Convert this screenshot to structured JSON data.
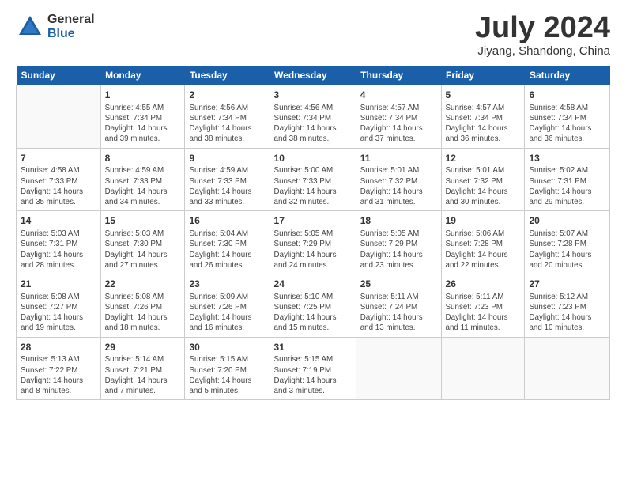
{
  "logo": {
    "general": "General",
    "blue": "Blue"
  },
  "header": {
    "month": "July 2024",
    "location": "Jiyang, Shandong, China"
  },
  "weekdays": [
    "Sunday",
    "Monday",
    "Tuesday",
    "Wednesday",
    "Thursday",
    "Friday",
    "Saturday"
  ],
  "weeks": [
    [
      {
        "day": "",
        "info": ""
      },
      {
        "day": "1",
        "info": "Sunrise: 4:55 AM\nSunset: 7:34 PM\nDaylight: 14 hours\nand 39 minutes."
      },
      {
        "day": "2",
        "info": "Sunrise: 4:56 AM\nSunset: 7:34 PM\nDaylight: 14 hours\nand 38 minutes."
      },
      {
        "day": "3",
        "info": "Sunrise: 4:56 AM\nSunset: 7:34 PM\nDaylight: 14 hours\nand 38 minutes."
      },
      {
        "day": "4",
        "info": "Sunrise: 4:57 AM\nSunset: 7:34 PM\nDaylight: 14 hours\nand 37 minutes."
      },
      {
        "day": "5",
        "info": "Sunrise: 4:57 AM\nSunset: 7:34 PM\nDaylight: 14 hours\nand 36 minutes."
      },
      {
        "day": "6",
        "info": "Sunrise: 4:58 AM\nSunset: 7:34 PM\nDaylight: 14 hours\nand 36 minutes."
      }
    ],
    [
      {
        "day": "7",
        "info": "Sunrise: 4:58 AM\nSunset: 7:33 PM\nDaylight: 14 hours\nand 35 minutes."
      },
      {
        "day": "8",
        "info": "Sunrise: 4:59 AM\nSunset: 7:33 PM\nDaylight: 14 hours\nand 34 minutes."
      },
      {
        "day": "9",
        "info": "Sunrise: 4:59 AM\nSunset: 7:33 PM\nDaylight: 14 hours\nand 33 minutes."
      },
      {
        "day": "10",
        "info": "Sunrise: 5:00 AM\nSunset: 7:33 PM\nDaylight: 14 hours\nand 32 minutes."
      },
      {
        "day": "11",
        "info": "Sunrise: 5:01 AM\nSunset: 7:32 PM\nDaylight: 14 hours\nand 31 minutes."
      },
      {
        "day": "12",
        "info": "Sunrise: 5:01 AM\nSunset: 7:32 PM\nDaylight: 14 hours\nand 30 minutes."
      },
      {
        "day": "13",
        "info": "Sunrise: 5:02 AM\nSunset: 7:31 PM\nDaylight: 14 hours\nand 29 minutes."
      }
    ],
    [
      {
        "day": "14",
        "info": "Sunrise: 5:03 AM\nSunset: 7:31 PM\nDaylight: 14 hours\nand 28 minutes."
      },
      {
        "day": "15",
        "info": "Sunrise: 5:03 AM\nSunset: 7:30 PM\nDaylight: 14 hours\nand 27 minutes."
      },
      {
        "day": "16",
        "info": "Sunrise: 5:04 AM\nSunset: 7:30 PM\nDaylight: 14 hours\nand 26 minutes."
      },
      {
        "day": "17",
        "info": "Sunrise: 5:05 AM\nSunset: 7:29 PM\nDaylight: 14 hours\nand 24 minutes."
      },
      {
        "day": "18",
        "info": "Sunrise: 5:05 AM\nSunset: 7:29 PM\nDaylight: 14 hours\nand 23 minutes."
      },
      {
        "day": "19",
        "info": "Sunrise: 5:06 AM\nSunset: 7:28 PM\nDaylight: 14 hours\nand 22 minutes."
      },
      {
        "day": "20",
        "info": "Sunrise: 5:07 AM\nSunset: 7:28 PM\nDaylight: 14 hours\nand 20 minutes."
      }
    ],
    [
      {
        "day": "21",
        "info": "Sunrise: 5:08 AM\nSunset: 7:27 PM\nDaylight: 14 hours\nand 19 minutes."
      },
      {
        "day": "22",
        "info": "Sunrise: 5:08 AM\nSunset: 7:26 PM\nDaylight: 14 hours\nand 18 minutes."
      },
      {
        "day": "23",
        "info": "Sunrise: 5:09 AM\nSunset: 7:26 PM\nDaylight: 14 hours\nand 16 minutes."
      },
      {
        "day": "24",
        "info": "Sunrise: 5:10 AM\nSunset: 7:25 PM\nDaylight: 14 hours\nand 15 minutes."
      },
      {
        "day": "25",
        "info": "Sunrise: 5:11 AM\nSunset: 7:24 PM\nDaylight: 14 hours\nand 13 minutes."
      },
      {
        "day": "26",
        "info": "Sunrise: 5:11 AM\nSunset: 7:23 PM\nDaylight: 14 hours\nand 11 minutes."
      },
      {
        "day": "27",
        "info": "Sunrise: 5:12 AM\nSunset: 7:23 PM\nDaylight: 14 hours\nand 10 minutes."
      }
    ],
    [
      {
        "day": "28",
        "info": "Sunrise: 5:13 AM\nSunset: 7:22 PM\nDaylight: 14 hours\nand 8 minutes."
      },
      {
        "day": "29",
        "info": "Sunrise: 5:14 AM\nSunset: 7:21 PM\nDaylight: 14 hours\nand 7 minutes."
      },
      {
        "day": "30",
        "info": "Sunrise: 5:15 AM\nSunset: 7:20 PM\nDaylight: 14 hours\nand 5 minutes."
      },
      {
        "day": "31",
        "info": "Sunrise: 5:15 AM\nSunset: 7:19 PM\nDaylight: 14 hours\nand 3 minutes."
      },
      {
        "day": "",
        "info": ""
      },
      {
        "day": "",
        "info": ""
      },
      {
        "day": "",
        "info": ""
      }
    ]
  ]
}
